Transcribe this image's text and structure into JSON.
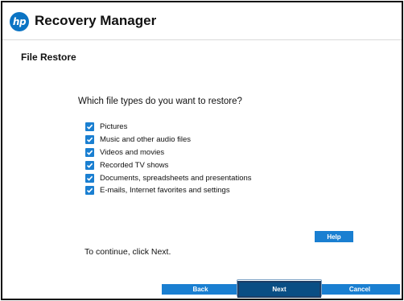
{
  "header": {
    "logo_text": "hp",
    "title": "Recovery Manager"
  },
  "page": {
    "title": "File Restore",
    "question": "Which file types do you want to restore?",
    "options": [
      {
        "label": "Pictures",
        "checked": true
      },
      {
        "label": "Music and other audio files",
        "checked": true
      },
      {
        "label": "Videos and movies",
        "checked": true
      },
      {
        "label": "Recorded TV shows",
        "checked": true
      },
      {
        "label": "Documents, spreadsheets and presentations",
        "checked": true
      },
      {
        "label": "E-mails, Internet favorites and settings",
        "checked": true
      }
    ],
    "help_label": "Help",
    "continue_text": "To continue, click Next."
  },
  "footer": {
    "back_label": "Back",
    "next_label": "Next",
    "cancel_label": "Cancel"
  },
  "colors": {
    "accent": "#1a7fd1",
    "focused_button": "#0a4e84",
    "hp_logo": "#0b74c4"
  }
}
